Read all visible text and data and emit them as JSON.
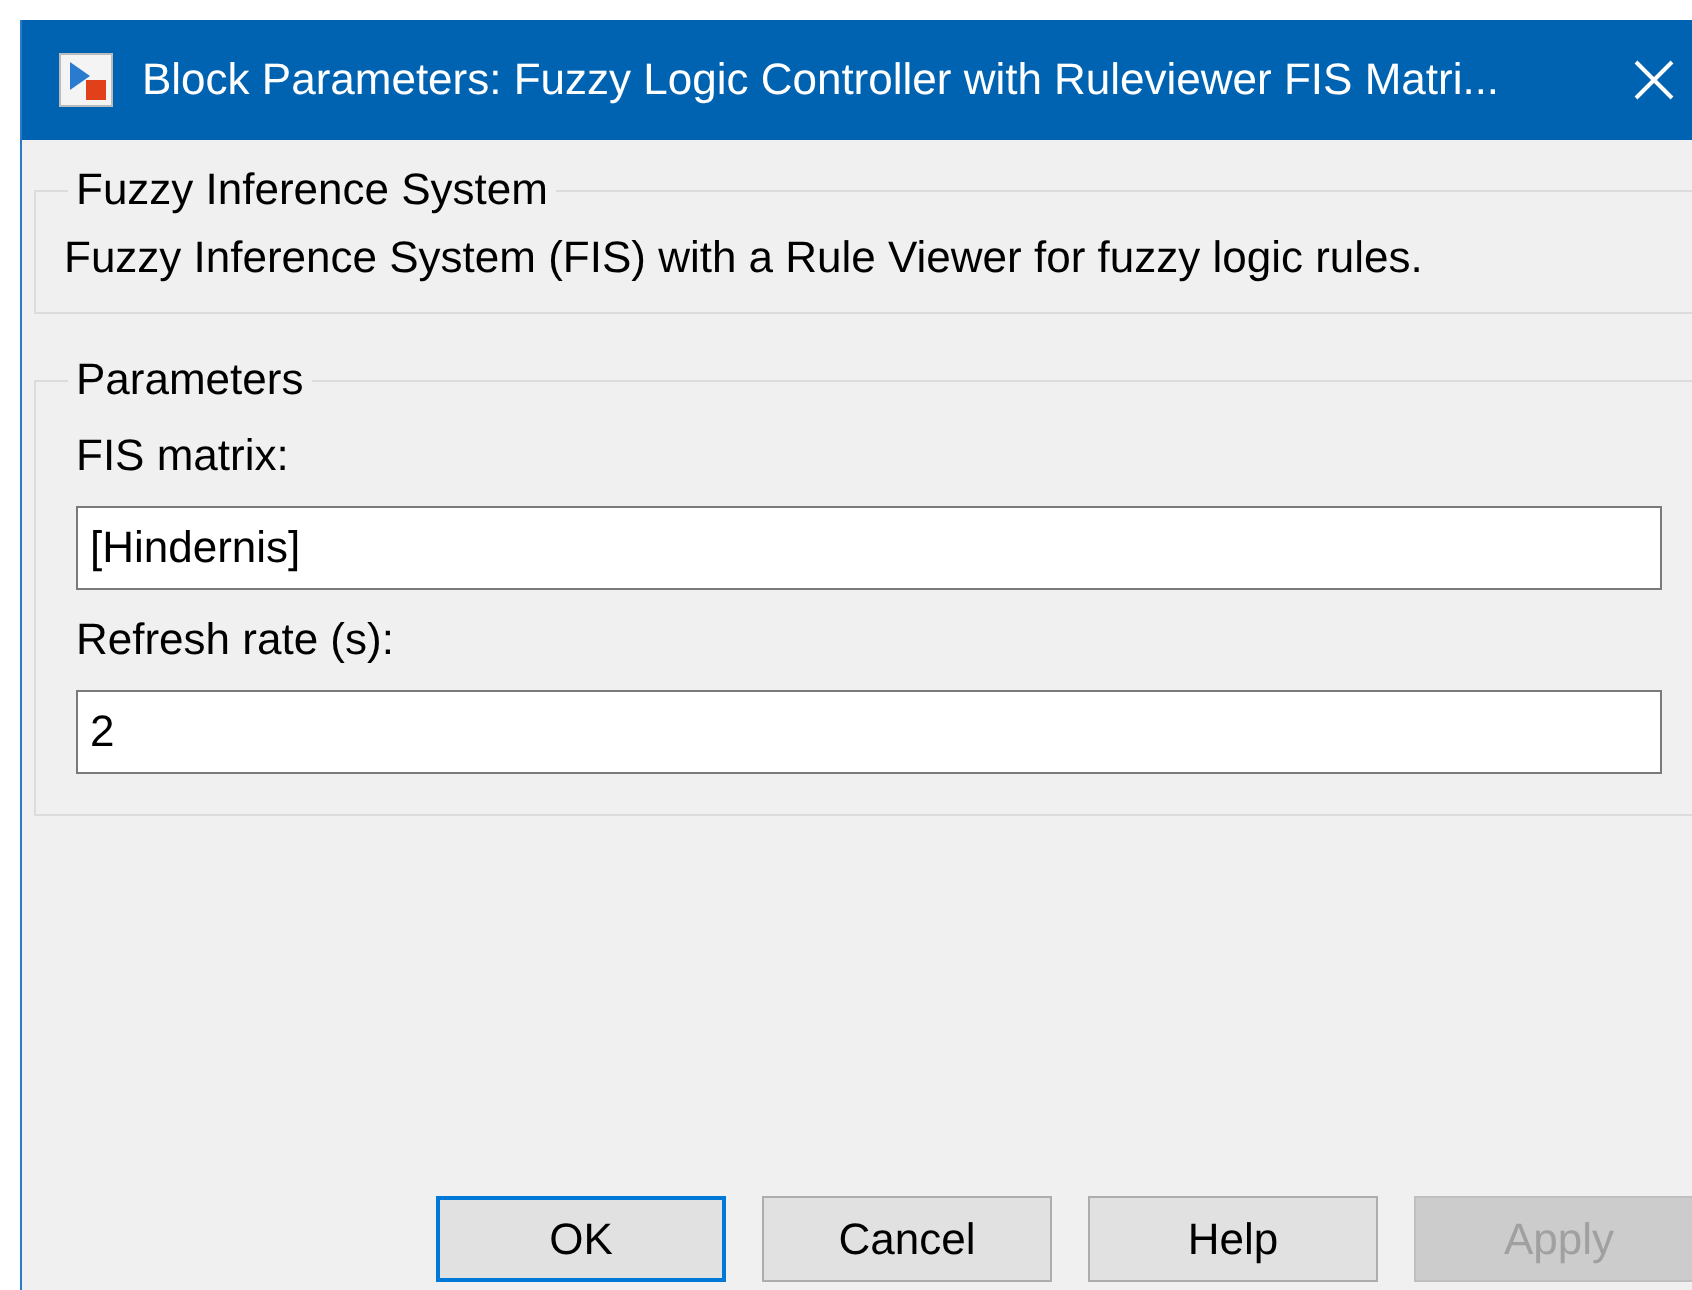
{
  "window": {
    "title": "Block Parameters: Fuzzy Logic Controller with Ruleviewer FIS Matri..."
  },
  "groups": [
    {
      "title": "Fuzzy Inference System",
      "description": "Fuzzy Inference System (FIS) with a Rule Viewer for fuzzy logic rules."
    },
    {
      "title": "Parameters",
      "fields": [
        {
          "label": "FIS matrix:",
          "value": "[Hindernis]"
        },
        {
          "label": "Refresh rate (s):",
          "value": "2"
        }
      ]
    }
  ],
  "buttons": [
    {
      "label": "OK",
      "default": true,
      "disabled": false
    },
    {
      "label": "Cancel",
      "default": false,
      "disabled": false
    },
    {
      "label": "Help",
      "default": false,
      "disabled": false
    },
    {
      "label": "Apply",
      "default": false,
      "disabled": true
    }
  ]
}
